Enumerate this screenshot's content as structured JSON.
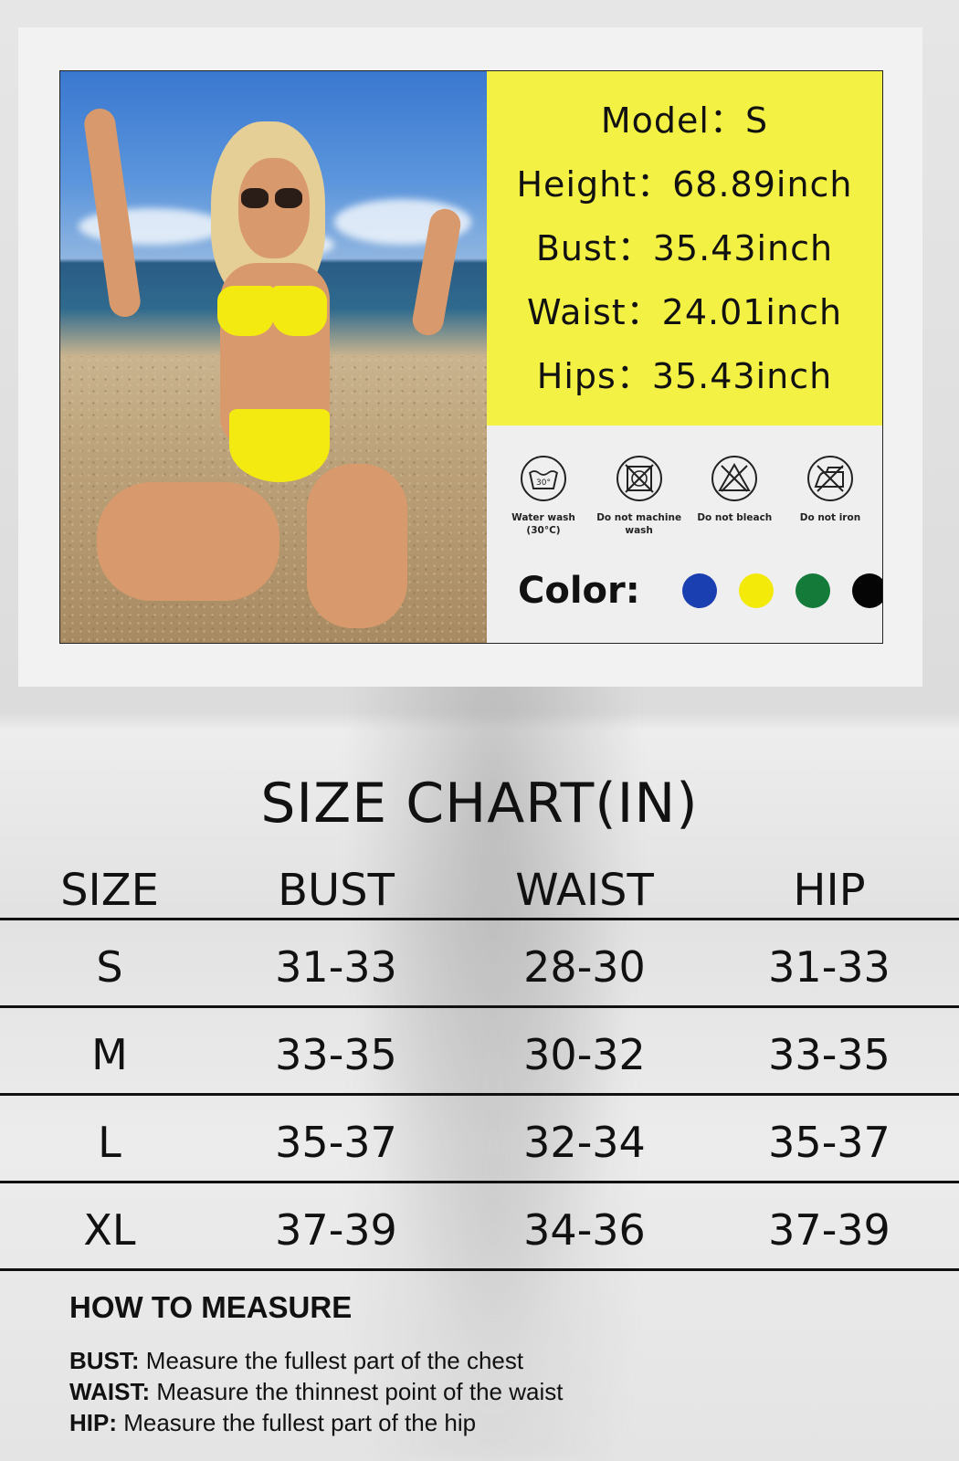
{
  "model_info": {
    "model": "Model：S",
    "height": "Height：68.89inch",
    "bust": "Bust：35.43inch",
    "waist": "Waist：24.01inch",
    "hips": "Hips：35.43inch"
  },
  "care": {
    "items": [
      {
        "icon": "water-wash-30-icon",
        "label": "Water wash (30°C)",
        "tub_text": "30°"
      },
      {
        "icon": "no-machine-wash-icon",
        "label": "Do not machine wash"
      },
      {
        "icon": "do-not-bleach-icon",
        "label": "Do not bleach"
      },
      {
        "icon": "do-not-iron-icon",
        "label": "Do not iron"
      }
    ]
  },
  "colors": {
    "label": "Color:",
    "swatches": [
      "#1a3fb0",
      "#f4ea0a",
      "#137a3a",
      "#050505"
    ]
  },
  "size_chart": {
    "title": "SIZE CHART(IN)",
    "headers": [
      "SIZE",
      "BUST",
      "WAIST",
      "HIP"
    ],
    "rows": [
      [
        "S",
        "31-33",
        "28-30",
        "31-33"
      ],
      [
        "M",
        "33-35",
        "30-32",
        "33-35"
      ],
      [
        "L",
        "35-37",
        "32-34",
        "35-37"
      ],
      [
        "XL",
        "37-39",
        "34-36",
        "37-39"
      ]
    ]
  },
  "how_to_measure": {
    "title": "HOW TO MEASURE",
    "lines": [
      {
        "term": "BUST:",
        "text": " Measure the fullest part of the chest"
      },
      {
        "term": "WAIST:",
        "text": " Measure the thinnest point of the waist"
      },
      {
        "term": "HIP:",
        "text": " Measure the fullest part of the hip"
      }
    ]
  }
}
